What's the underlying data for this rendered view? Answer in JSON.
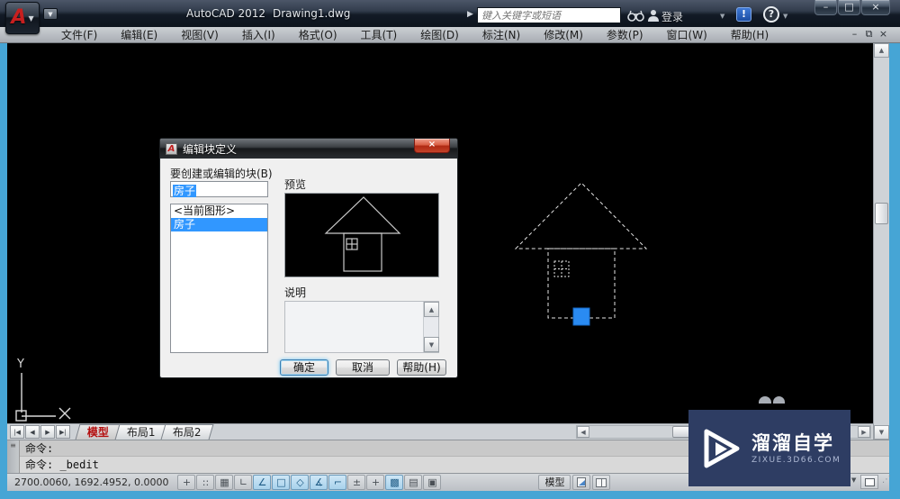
{
  "titlebar": {
    "app_title": "AutoCAD 2012",
    "doc_title": "Drawing1.dwg",
    "search_placeholder": "键入关键字或短语",
    "signin_label": "登录",
    "window_controls": {
      "minimize": "–",
      "maximize": "□",
      "close": "×"
    }
  },
  "menubar": {
    "items": [
      {
        "name": "file",
        "label": "文件(F)"
      },
      {
        "name": "edit",
        "label": "编辑(E)"
      },
      {
        "name": "view",
        "label": "视图(V)"
      },
      {
        "name": "insert",
        "label": "插入(I)"
      },
      {
        "name": "format",
        "label": "格式(O)"
      },
      {
        "name": "tools",
        "label": "工具(T)"
      },
      {
        "name": "draw",
        "label": "绘图(D)"
      },
      {
        "name": "dimension",
        "label": "标注(N)"
      },
      {
        "name": "modify",
        "label": "修改(M)"
      },
      {
        "name": "parametric",
        "label": "参数(P)"
      },
      {
        "name": "window",
        "label": "窗口(W)"
      },
      {
        "name": "help",
        "label": "帮助(H)"
      }
    ],
    "mdi_controls": {
      "minimize": "–",
      "restore": "⧉",
      "close": "×"
    }
  },
  "dialog": {
    "title": "编辑块定义",
    "block_label": "要创建或编辑的块(B)",
    "block_input_value": "房子",
    "list_items": [
      {
        "label": "<当前图形>",
        "selected": false
      },
      {
        "label": "房子",
        "selected": true
      }
    ],
    "preview_label": "预览",
    "description_label": "说明",
    "buttons": {
      "ok": "确定",
      "cancel": "取消",
      "help": "帮助(H)"
    },
    "close_glyph": "×"
  },
  "canvas": {
    "ucs_y_label": "Y",
    "ucs_x_label": "X"
  },
  "tabs": {
    "model": "模型",
    "layout1": "布局1",
    "layout2": "布局2"
  },
  "command": {
    "line1": "命令:",
    "line2": "命令: _bedit"
  },
  "statusbar": {
    "coords": "2700.0060, 1692.4952, 0.0000",
    "toggles": [
      {
        "name": "infer-constraints",
        "glyph": "+",
        "active": false
      },
      {
        "name": "snap-mode",
        "glyph": "::",
        "active": false
      },
      {
        "name": "grid-display",
        "glyph": "▦",
        "active": false
      },
      {
        "name": "ortho-mode",
        "glyph": "∟",
        "active": false
      },
      {
        "name": "polar-tracking",
        "glyph": "∠",
        "active": true
      },
      {
        "name": "object-snap",
        "glyph": "□",
        "active": true
      },
      {
        "name": "3d-object-snap",
        "glyph": "◇",
        "active": true
      },
      {
        "name": "object-snap-tracking",
        "glyph": "∡",
        "active": true
      },
      {
        "name": "dynamic-ucs",
        "glyph": "⌐",
        "active": true
      },
      {
        "name": "dynamic-input",
        "glyph": "±",
        "active": false
      },
      {
        "name": "lineweight",
        "glyph": "+",
        "active": false
      },
      {
        "name": "transparency",
        "glyph": "▩",
        "active": true
      },
      {
        "name": "quick-properties",
        "glyph": "▤",
        "active": false
      },
      {
        "name": "selection-cycling",
        "glyph": "▣",
        "active": false
      }
    ],
    "model_button": "模型"
  },
  "watermark": {
    "title": "溜溜自学",
    "subtitle": "ZIXUE.3D66.COM"
  },
  "colors": {
    "selection_blue": "#3197ff",
    "grip_blue": "#2a8bf2",
    "active_tab_red": "#b40f0f",
    "frame_blue": "#46a5d5",
    "watermark_bg": "#2e3d63"
  }
}
